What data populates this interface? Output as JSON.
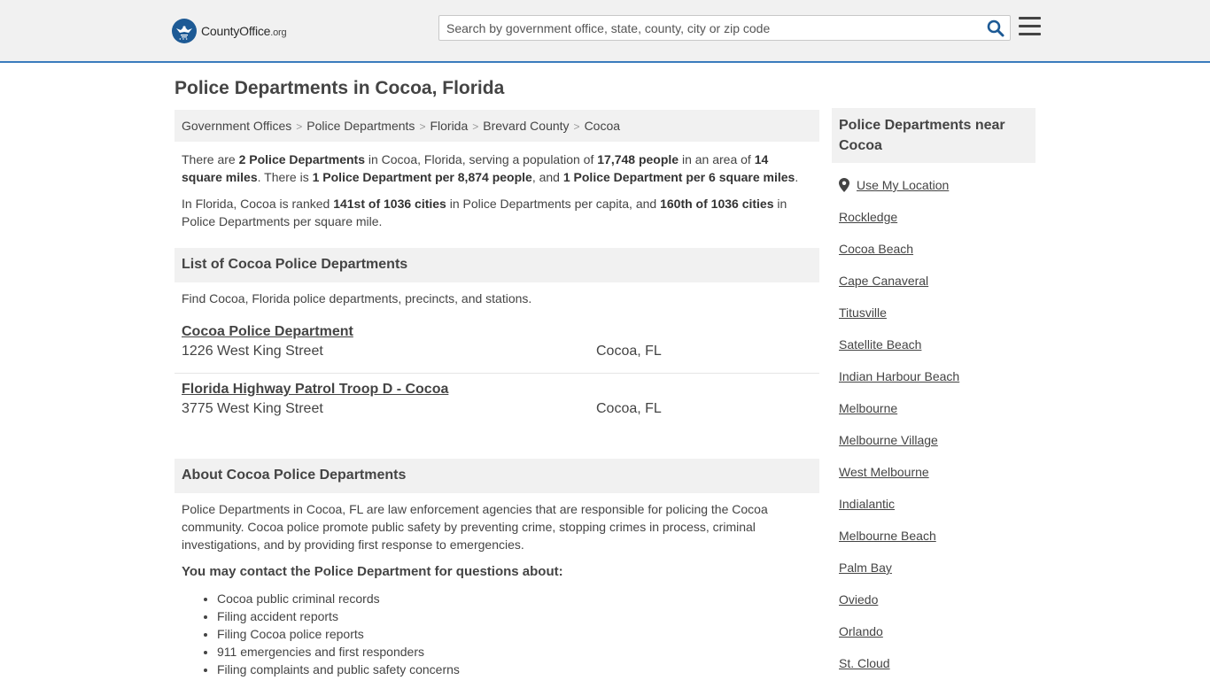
{
  "header": {
    "logo_main": "CountyOffice",
    "logo_tld": ".org",
    "search_placeholder": "Search by government office, state, county, city or zip code"
  },
  "page_title": "Police Departments in Cocoa, Florida",
  "breadcrumb": [
    "Government Offices",
    "Police Departments",
    "Florida",
    "Brevard County",
    "Cocoa"
  ],
  "intro": {
    "p1": {
      "t1": "There are ",
      "b1": "2 Police Departments",
      "t2": " in Cocoa, Florida, serving a population of ",
      "b2": "17,748 people",
      "t3": " in an area of ",
      "b3": "14 square miles",
      "t4": ". There is ",
      "b4": "1 Police Department per 8,874 people",
      "t5": ", and ",
      "b5": "1 Police Department per 6 square miles",
      "t6": "."
    },
    "p2": {
      "t1": "In Florida, Cocoa is ranked ",
      "b1": "141st of 1036 cities",
      "t2": " in Police Departments per capita, and ",
      "b2": "160th of 1036 cities",
      "t3": " in Police Departments per square mile."
    }
  },
  "list_section": {
    "title": "List of Cocoa Police Departments",
    "description": "Find Cocoa, Florida police departments, precincts, and stations.",
    "items": [
      {
        "name": "Cocoa Police Department",
        "address": "1226 West King Street",
        "city": "Cocoa, FL"
      },
      {
        "name": "Florida Highway Patrol Troop D - Cocoa",
        "address": "3775 West King Street",
        "city": "Cocoa, FL"
      }
    ]
  },
  "about_section": {
    "title": "About Cocoa Police Departments",
    "text": "Police Departments in Cocoa, FL are law enforcement agencies that are responsible for policing the Cocoa community. Cocoa police promote public safety by preventing crime, stopping crimes in process, criminal investigations, and by providing first response to emergencies.",
    "contact_title": "You may contact the Police Department for questions about:",
    "bullets": [
      "Cocoa public criminal records",
      "Filing accident reports",
      "Filing Cocoa police reports",
      "911 emergencies and first responders",
      "Filing complaints and public safety concerns"
    ]
  },
  "sidebar": {
    "title": "Police Departments near Cocoa",
    "location_label": "Use My Location",
    "cities": [
      "Rockledge",
      "Cocoa Beach",
      "Cape Canaveral",
      "Titusville",
      "Satellite Beach",
      "Indian Harbour Beach",
      "Melbourne",
      "Melbourne Village",
      "West Melbourne",
      "Indialantic",
      "Melbourne Beach",
      "Palm Bay",
      "Oviedo",
      "Orlando",
      "St. Cloud"
    ]
  },
  "colors": {
    "header_bg": "#f1f1f1",
    "accent": "#3a7bbd",
    "logo_blue": "#1d5a95",
    "search_icon": "#1d5a95",
    "text": "#444444"
  }
}
